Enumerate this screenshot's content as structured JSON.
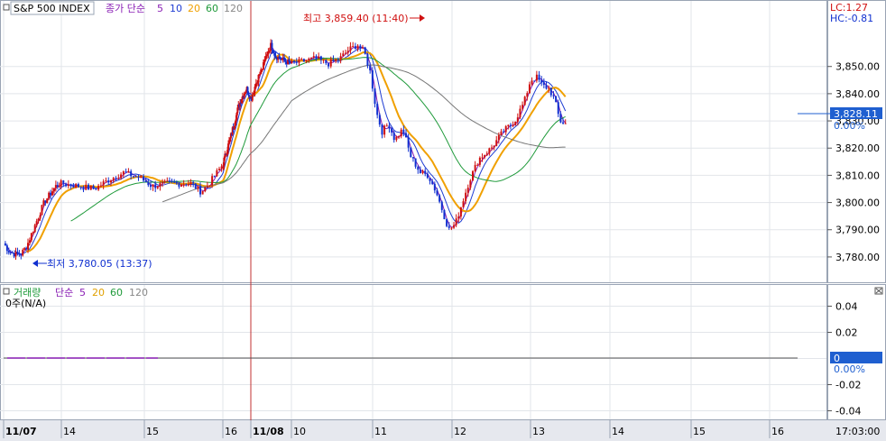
{
  "symbol": "S&P 500 INDEX",
  "price_legend": {
    "title": "종가 단순",
    "periods": [
      {
        "label": "5",
        "color": "#8a1fb5"
      },
      {
        "label": "10",
        "color": "#1e3cd2"
      },
      {
        "label": "20",
        "color": "#f0a000"
      },
      {
        "label": "60",
        "color": "#1f9a3a"
      },
      {
        "label": "120",
        "color": "#888888"
      }
    ]
  },
  "volume_legend": {
    "title": "거래량",
    "ma_title": "단순",
    "periods": [
      {
        "label": "5",
        "color": "#8a1fb5"
      },
      {
        "label": "20",
        "color": "#e0a000"
      },
      {
        "label": "60",
        "color": "#1f9a3a"
      },
      {
        "label": "120",
        "color": "#888888"
      }
    ],
    "volume_text": "0주(N/A)"
  },
  "indicators": {
    "lc": "LC:1.27",
    "hc": "HC:-0.81"
  },
  "current_price": {
    "value": "3,828.11",
    "change": "0.00%"
  },
  "volume_current": {
    "value": "0",
    "change": "0.00%"
  },
  "annotations": {
    "high": "최고 3,859.40 (11:40)",
    "low": "최저 3,780.05 (13:37)"
  },
  "time_label": "17:03:00",
  "colors": {
    "candle_up": "#d01010",
    "candle_down": "#1030d0",
    "ma5": "#8a1fb5",
    "ma10": "#1e3cd2",
    "ma20": "#f0a000",
    "ma60": "#1f9a3a",
    "ma120": "#777777",
    "price_box": "#1f5fd0",
    "day_separator": "#c03030"
  },
  "chart_data": {
    "type": "line",
    "series_kind": "candlestick",
    "x_labels": [
      "11/07",
      "14",
      "15",
      "16",
      "11/08",
      "10",
      "11",
      "12",
      "13",
      "14",
      "15",
      "16"
    ],
    "price_axis": {
      "ylim": [
        3775,
        3863
      ],
      "ticks": [
        "3,780.00",
        "3,790.00",
        "3,800.00",
        "3,810.00",
        "3,820.00",
        "3,830.00",
        "3,840.00",
        "3,850.00"
      ]
    },
    "volume_axis": {
      "ylim": [
        -0.05,
        0.05
      ],
      "ticks": [
        "0.04",
        "0.02",
        "0",
        "-0.02",
        "-0.04"
      ]
    },
    "close_anchors": [
      [
        0,
        3785
      ],
      [
        0.1,
        3782
      ],
      [
        0.2,
        3781
      ],
      [
        0.3,
        3781
      ],
      [
        0.4,
        3784
      ],
      [
        0.55,
        3792
      ],
      [
        0.7,
        3800
      ],
      [
        0.9,
        3806
      ],
      [
        1.0,
        3807
      ],
      [
        1.2,
        3806
      ],
      [
        1.4,
        3805
      ],
      [
        1.55,
        3808
      ],
      [
        1.75,
        3811
      ],
      [
        1.95,
        3809
      ],
      [
        2.1,
        3806
      ],
      [
        2.3,
        3807
      ],
      [
        2.6,
        3807
      ],
      [
        2.72,
        3804
      ],
      [
        2.8,
        3806
      ],
      [
        2.95,
        3812
      ],
      [
        3.1,
        3818
      ],
      [
        3.25,
        3823
      ],
      [
        3.4,
        3829
      ],
      [
        3.55,
        3835
      ],
      [
        3.7,
        3839
      ],
      [
        3.85,
        3842
      ],
      [
        4.0,
        3838
      ],
      [
        4.15,
        3845
      ],
      [
        4.3,
        3850
      ],
      [
        4.4,
        3855
      ],
      [
        4.5,
        3858
      ],
      [
        4.6,
        3854
      ],
      [
        4.7,
        3853
      ],
      [
        4.85,
        3852
      ],
      [
        5.0,
        3851
      ],
      [
        5.15,
        3852
      ],
      [
        5.3,
        3853
      ],
      [
        5.45,
        3851
      ],
      [
        5.6,
        3853
      ],
      [
        5.7,
        3856
      ],
      [
        5.82,
        3858
      ],
      [
        5.9,
        3855
      ],
      [
        5.97,
        3848
      ],
      [
        6.05,
        3833
      ],
      [
        6.12,
        3826
      ],
      [
        6.2,
        3829
      ],
      [
        6.28,
        3823
      ],
      [
        6.38,
        3827
      ],
      [
        6.48,
        3817
      ],
      [
        6.6,
        3811
      ],
      [
        6.7,
        3810
      ],
      [
        6.8,
        3804
      ],
      [
        6.88,
        3797
      ],
      [
        6.96,
        3790
      ],
      [
        7.04,
        3792
      ],
      [
        7.12,
        3799
      ],
      [
        7.22,
        3808
      ],
      [
        7.34,
        3816
      ],
      [
        7.5,
        3820
      ],
      [
        7.65,
        3826
      ],
      [
        7.8,
        3830
      ],
      [
        7.92,
        3837
      ],
      [
        8.0,
        3845
      ],
      [
        8.08,
        3846
      ],
      [
        8.15,
        3843
      ],
      [
        8.23,
        3842
      ],
      [
        8.3,
        3838
      ],
      [
        8.37,
        3830
      ],
      [
        8.44,
        3829
      ]
    ]
  }
}
